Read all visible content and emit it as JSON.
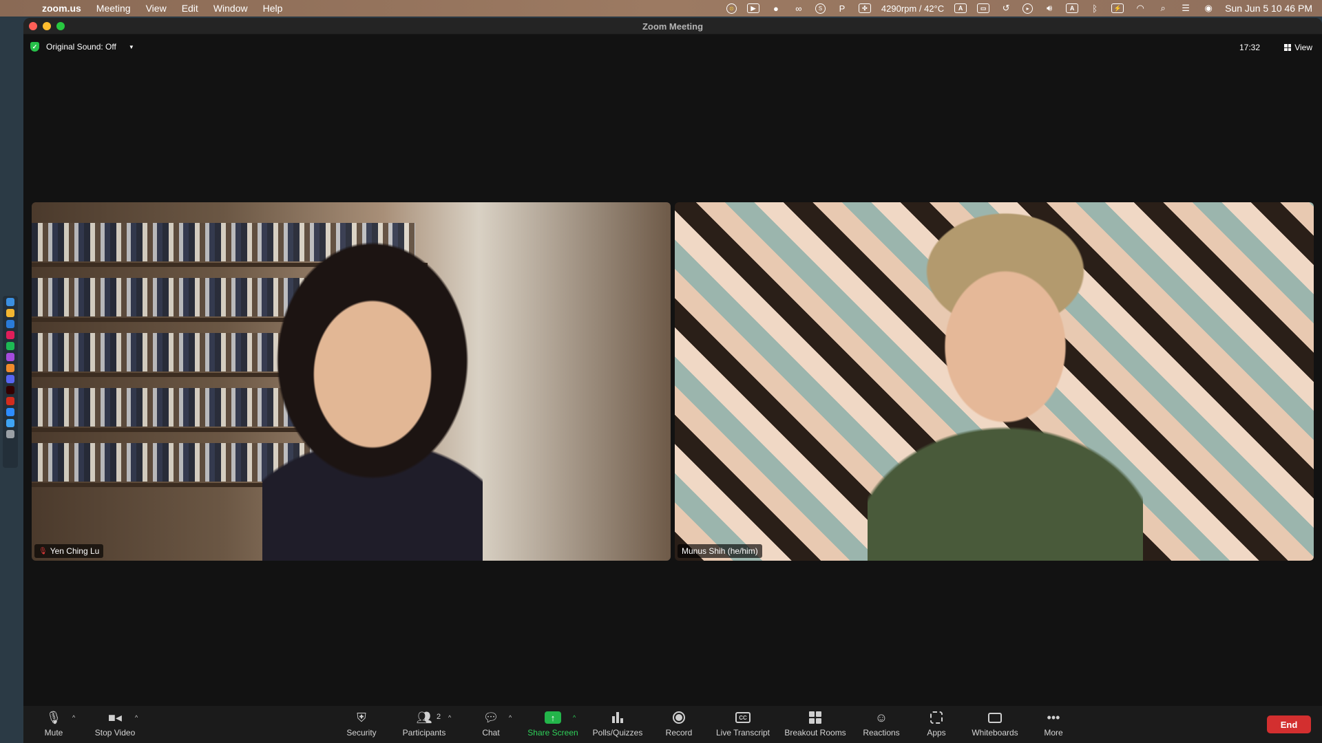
{
  "menubar": {
    "app_name": "zoom.us",
    "items": [
      "Meeting",
      "View",
      "Edit",
      "Window",
      "Help"
    ],
    "fan_status": "4290rpm / 42°C",
    "clock": "Sun Jun 5  10 46 PM"
  },
  "window": {
    "title": "Zoom Meeting"
  },
  "meeting": {
    "sound_status": "Original Sound: Off",
    "elapsed": "17:32",
    "view_label": "View",
    "participants": [
      {
        "name": "Yen Ching Lu",
        "muted": true
      },
      {
        "name": "Munus Shih (he/him)",
        "muted": false
      }
    ]
  },
  "toolbar": {
    "mute": "Mute",
    "stop_video": "Stop Video",
    "security": "Security",
    "participants": "Participants",
    "participants_count": "2",
    "chat": "Chat",
    "share_screen": "Share Screen",
    "polls": "Polls/Quizzes",
    "record": "Record",
    "live_transcript": "Live Transcript",
    "cc_text": "CC",
    "breakout_rooms": "Breakout Rooms",
    "reactions": "Reactions",
    "apps": "Apps",
    "whiteboards": "Whiteboards",
    "more": "More",
    "end": "End"
  },
  "colors": {
    "accent_green": "#2fd15a",
    "end_red": "#d32f2f",
    "share_green": "#23b54a"
  }
}
